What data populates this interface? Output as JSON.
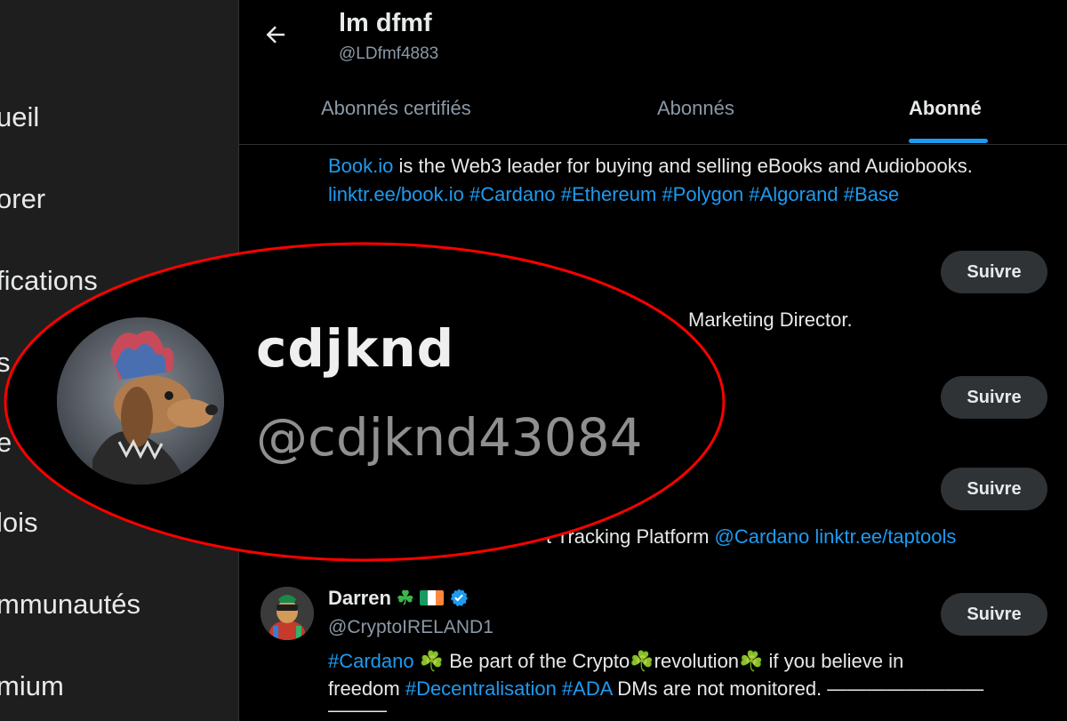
{
  "sidebar": {
    "items": [
      {
        "label": "ueil"
      },
      {
        "label": "orer"
      },
      {
        "label": "fications"
      },
      {
        "label": "s"
      },
      {
        "label": "e"
      },
      {
        "label": "lois"
      },
      {
        "label": "mmunautés"
      },
      {
        "label": "mium"
      }
    ]
  },
  "header": {
    "title": "lm dfmf",
    "handle": "@LDfmf4883",
    "tabs": [
      {
        "label": "Abonnés certifiés"
      },
      {
        "label": "Abonnés"
      },
      {
        "label": "Abonné"
      }
    ]
  },
  "list": {
    "bookio_bio_1_link": "Book.io",
    "bookio_bio_1_text": " is the Web3 leader for buying and selling eBooks and Audiobooks.",
    "bookio_bio_2": "linktr.ee/book.io #Cardano #Ethereum #Polygon #Algorand #Base",
    "marketing_text": "Marketing Director.",
    "taptools_text": "t Tracking Platform ",
    "taptools_links": "@Cardano linktr.ee/taptools",
    "follow_label": "Suivre",
    "darren": {
      "name": "Darren",
      "handle": "@CryptoIRELAND1",
      "bio1_tag": "#Cardano",
      "bio1_text": " ☘️ Be part of the Crypto☘️revolution☘️ if you believe in",
      "bio2_word": "freedom ",
      "bio2_tags": "#Decentralisation #ADA",
      "bio2_text": " DMs are not monitored. ————————",
      "bio3": "———"
    }
  },
  "zoom": {
    "name": "cdjknd",
    "handle": "@cdjknd43084"
  },
  "colors": {
    "accent": "#1d9bf0",
    "annotation": "#ff0000",
    "sidebar_bg": "#1e1e1e"
  }
}
